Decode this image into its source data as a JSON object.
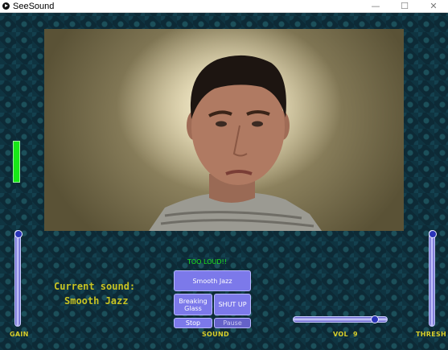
{
  "window": {
    "title": "SeeSound",
    "minimize": "—",
    "maximize": "☐",
    "close": "✕"
  },
  "status": {
    "warning": "TOO LOUD!!"
  },
  "current_sound": {
    "label": "Current sound:",
    "value": "Smooth Jazz"
  },
  "buttons": {
    "smooth_jazz": "Smooth Jazz",
    "breaking_glass": "Breaking Glass",
    "shut_up": "SHUT UP",
    "stop": "Stop",
    "pause": "Pause"
  },
  "labels": {
    "gain": "GAIN",
    "sound": "SOUND",
    "vol": "VOL",
    "vol_value": "9",
    "thresh": "THRESH"
  },
  "controls": {
    "gain_level": 1.0,
    "thresh_level": 1.0,
    "volume_level": 0.9,
    "input_meter_level": 1.0
  },
  "colors": {
    "background": "#0d2a36",
    "label_yellow": "#d8cf2a",
    "button_purple": "#7c79ea",
    "meter_green": "#17e817",
    "warning_green": "#1ee81e"
  }
}
